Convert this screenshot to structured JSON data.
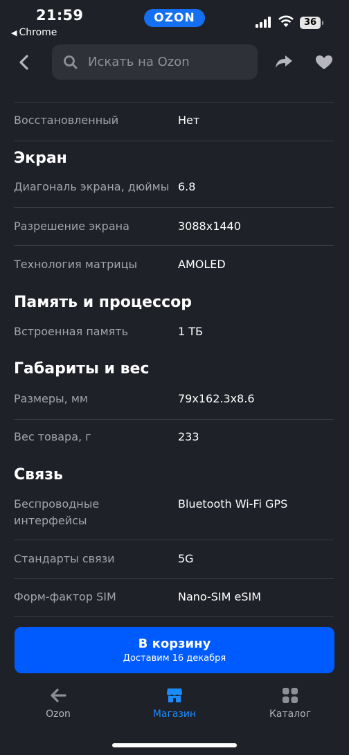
{
  "status": {
    "time": "21:59",
    "back_app": "Chrome",
    "brand": "OZON",
    "battery": "36"
  },
  "search": {
    "placeholder": "Искать на Ozon"
  },
  "specs": {
    "top_row": {
      "key": "Восстановленный",
      "value": "Нет"
    },
    "sections": [
      {
        "title": "Экран",
        "rows": [
          {
            "key": "Диагональ экрана, дюймы",
            "value": "6.8"
          },
          {
            "key": "Разрешение экрана",
            "value": "3088x1440"
          },
          {
            "key": "Технология матрицы",
            "value": "AMOLED"
          }
        ]
      },
      {
        "title": "Память и процессор",
        "rows": [
          {
            "key": "Встроенная память",
            "value": "1 ТБ"
          }
        ]
      },
      {
        "title": "Габариты и вес",
        "rows": [
          {
            "key": "Размеры, мм",
            "value": "79x162.3x8.6"
          },
          {
            "key": "Вес товара, г",
            "value": "233"
          }
        ]
      },
      {
        "title": "Связь",
        "rows": [
          {
            "key": "Беспроводные интерфейсы",
            "value": "Bluetooth Wi-Fi GPS"
          },
          {
            "key": "Стандарты связи",
            "value": "5G"
          },
          {
            "key": "Форм-фактор SIM",
            "value": "Nano-SIM eSIM"
          }
        ]
      }
    ]
  },
  "cart": {
    "label": "В корзину",
    "delivery": "Доставим 16 декабря"
  },
  "tabs": [
    {
      "label": "Ozon",
      "icon": "arrow-left-icon"
    },
    {
      "label": "Магазин",
      "icon": "store-icon",
      "active": true
    },
    {
      "label": "Каталог",
      "icon": "grid-icon"
    }
  ],
  "colors": {
    "background": "#1f2128",
    "accent": "#005bff",
    "active_tab": "#1a8cff"
  }
}
